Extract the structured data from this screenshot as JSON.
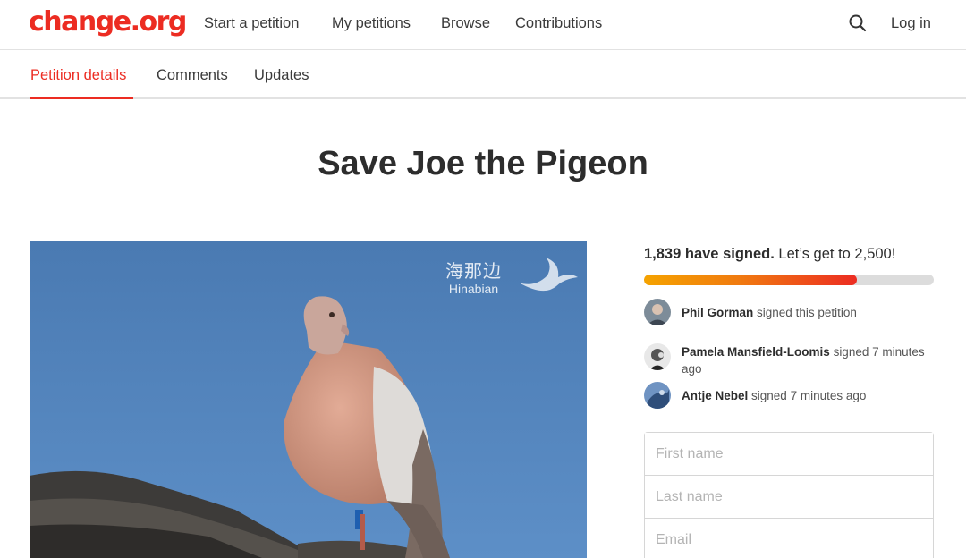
{
  "brand": {
    "logo_text": "change.org",
    "accent_color": "#ec2c22"
  },
  "nav": {
    "links": [
      {
        "label": "Start a petition"
      },
      {
        "label": "My petitions"
      },
      {
        "label": "Browse"
      },
      {
        "label": "Contributions"
      }
    ],
    "search_icon": "search-icon",
    "login_label": "Log in"
  },
  "tabs": [
    {
      "label": "Petition details",
      "active": true
    },
    {
      "label": "Comments",
      "active": false
    },
    {
      "label": "Updates",
      "active": false
    }
  ],
  "petition": {
    "title": "Save Joe the Pigeon",
    "image_watermark": {
      "chinese": "海那边",
      "latin": "Hinabian"
    }
  },
  "signatures": {
    "count_bold": "1,839 have signed.",
    "goal_text": "Let’s get to 2,500!",
    "signed": 1839,
    "goal": 2500,
    "recent_signers": [
      {
        "name": "Phil Gorman",
        "action": "signed this petition"
      },
      {
        "name": "Pamela Mansfield-Loomis",
        "action": "signed 7 minutes ago"
      },
      {
        "name": "Antje Nebel",
        "action": "signed 7 minutes ago"
      }
    ]
  },
  "form": {
    "first_name_placeholder": "First name",
    "last_name_placeholder": "Last name",
    "email_placeholder": "Email"
  }
}
